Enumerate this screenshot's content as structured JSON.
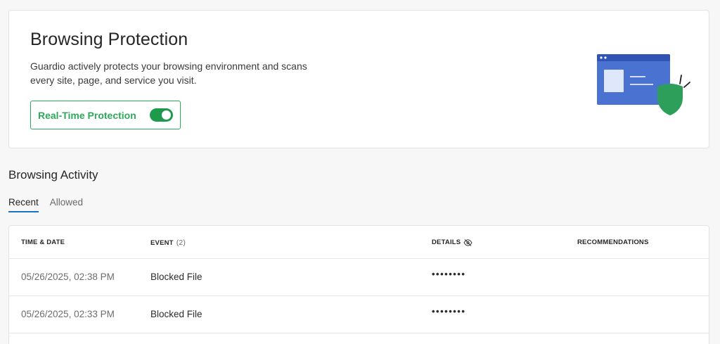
{
  "protection": {
    "title": "Browsing Protection",
    "description": "Guardio actively protects your browsing environment and scans every site, page, and service you visit.",
    "toggle_label": "Real-Time Protection",
    "toggle_on": true
  },
  "activity": {
    "title": "Browsing Activity",
    "tabs": [
      {
        "label": "Recent",
        "active": true
      },
      {
        "label": "Allowed",
        "active": false
      }
    ],
    "table": {
      "headers": {
        "time": "TIME & DATE",
        "event": "EVENT",
        "event_count": "(2)",
        "details": "DETAILS",
        "recommendations": "RECOMMENDATIONS"
      },
      "rows": [
        {
          "time": "05/26/2025, 02:38 PM",
          "event": "Blocked File",
          "details": "••••••••",
          "recommendation": ""
        },
        {
          "time": "05/26/2025, 02:33 PM",
          "event": "Blocked File",
          "details": "••••••••",
          "recommendation": ""
        }
      ]
    }
  },
  "colors": {
    "accent_green": "#2eaa5c",
    "toggle_green": "#1f9a4d",
    "tab_underline": "#1a73c8",
    "illustration_blue": "#4a72d1",
    "illustration_shield": "#2e9e5b"
  },
  "icons": {
    "details_header": "eye-off-icon",
    "illustration": "browser-shield-illustration"
  }
}
